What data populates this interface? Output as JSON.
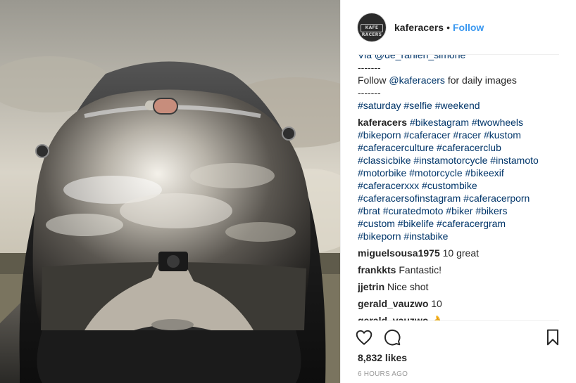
{
  "header": {
    "username": "kaferacers",
    "separator": "•",
    "follow_label": "Follow",
    "avatar_text": "KAFE RACERS"
  },
  "caption_tail": {
    "via": "Via @de_ranieri_simone",
    "rule1": "-------",
    "follow_prefix": "Follow ",
    "follow_mention": "@kaferacers",
    "follow_suffix": " for daily images",
    "rule2": "-------",
    "tags1": "#saturday #selfie #weekend"
  },
  "owner_comment": {
    "user": "kaferacers",
    "lines": [
      "#bikestagram #twowheels",
      "#bikeporn #caferacer #racer #kustom",
      "#caferacerculture #caferacerclub",
      "#classicbike #instamotorcycle #instamoto",
      "#motorbike #motorcycle #bikeexif",
      "#caferacerxxx #custombike",
      "#caferacersofinstagram #caferacerporn",
      "#brat #curatedmoto #biker #bikers",
      "#custom #bikelife #caferacergram",
      "#bikeporn #instabike"
    ]
  },
  "comments": [
    {
      "user": "miguelsousa1975",
      "text": "10 great"
    },
    {
      "user": "frankkts",
      "text": "Fantastic!"
    },
    {
      "user": "jjetrin",
      "text": "Nice shot"
    },
    {
      "user": "gerald_vauzwo",
      "text": "10"
    },
    {
      "user": "gerald_vauzwo",
      "text": "👌"
    }
  ],
  "likes": "8,832 likes",
  "time": "6 HOURS AGO",
  "icons": {
    "like": "heart-icon",
    "comment": "comment-bubble-icon",
    "save": "bookmark-icon"
  }
}
